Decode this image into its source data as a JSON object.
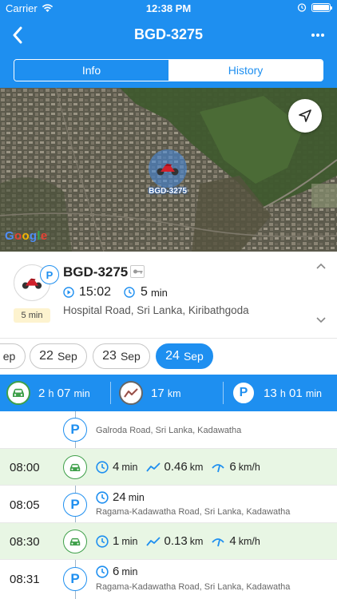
{
  "status_bar": {
    "carrier": "Carrier",
    "time": "12:38 PM"
  },
  "nav": {
    "title": "BGD-3275"
  },
  "tabs": [
    {
      "label": "Info",
      "active": true
    },
    {
      "label": "History",
      "active": false
    }
  ],
  "map": {
    "marker_label": "BGD-3275",
    "google_logo": "Google"
  },
  "vehicle": {
    "plate": "BGD-3275",
    "time": "15:02",
    "duration_value": "5",
    "duration_unit": "min",
    "parked_chip": "5 min",
    "address": "Hospital Road, Sri Lanka, Kiribathgoda"
  },
  "dates": [
    {
      "day": "",
      "month": "ep"
    },
    {
      "day": "22",
      "month": "Sep"
    },
    {
      "day": "23",
      "month": "Sep"
    },
    {
      "day": "24",
      "month": "Sep",
      "active": true
    }
  ],
  "summary": {
    "drive_h": "2",
    "drive_h_unit": "h",
    "drive_m": "07",
    "drive_m_unit": "min",
    "distance": "17",
    "distance_unit": "km",
    "park_h": "13",
    "park_h_unit": "h",
    "park_m": "01",
    "park_m_unit": "min"
  },
  "timeline": [
    {
      "type": "park",
      "time": "",
      "address": "Galroda Road, Sri Lanka, Kadawatha"
    },
    {
      "type": "drive",
      "time": "08:00",
      "duration": "4",
      "duration_unit": "min",
      "distance": "0.46",
      "distance_unit": "km",
      "speed": "6",
      "speed_unit": "km/h"
    },
    {
      "type": "park",
      "time": "08:05",
      "duration": "24",
      "duration_unit": "min",
      "address": "Ragama-Kadawatha Road, Sri Lanka, Kadawatha"
    },
    {
      "type": "drive",
      "time": "08:30",
      "duration": "1",
      "duration_unit": "min",
      "distance": "0.13",
      "distance_unit": "km",
      "speed": "4",
      "speed_unit": "km/h"
    },
    {
      "type": "park",
      "time": "08:31",
      "duration": "6",
      "duration_unit": "min",
      "address": "Ragama-Kadawatha Road, Sri Lanka, Kadawatha"
    }
  ],
  "colors": {
    "primary": "#1e8ff0",
    "drive_green": "#3fa04a",
    "drive_row": "#e8f6e4",
    "chip": "#fdf3cf"
  },
  "icons": {
    "back": "chevron-left-icon",
    "more": "more-icon",
    "locate": "navigation-arrow-icon",
    "car": "car-icon",
    "distance": "trend-line-icon",
    "park": "parking-icon",
    "clock": "clock-icon",
    "speed": "speedometer-icon"
  }
}
